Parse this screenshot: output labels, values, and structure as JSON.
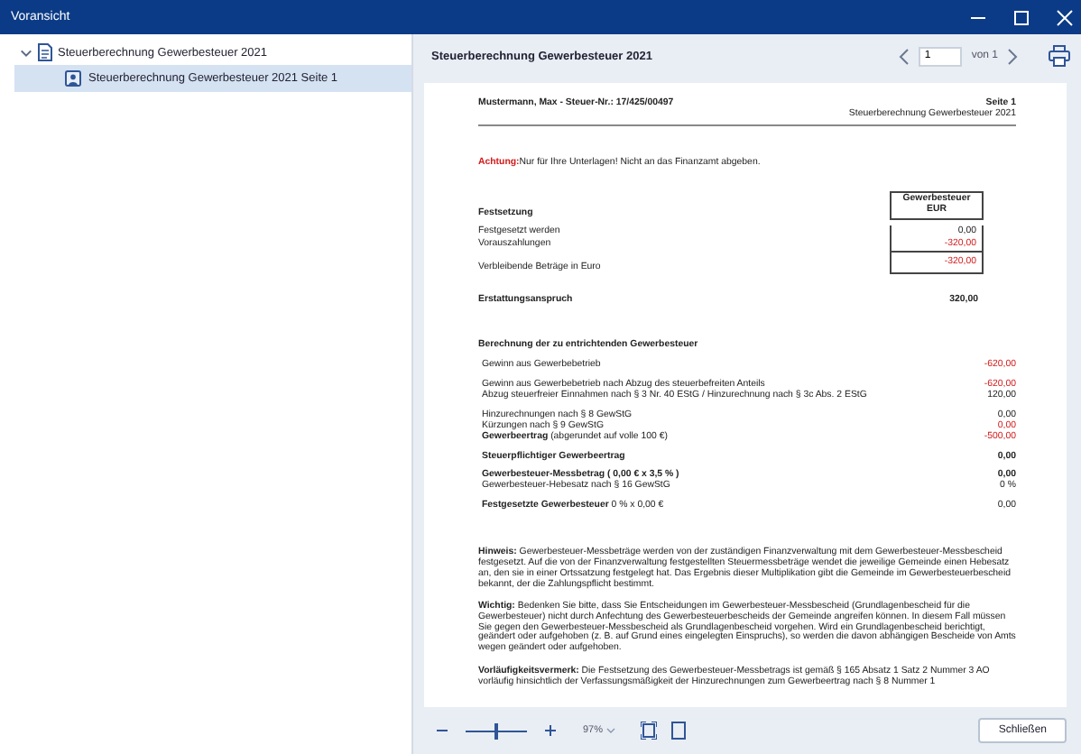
{
  "window": {
    "title": "Voransicht"
  },
  "tree": [
    {
      "label": "Steuerberechnung Gewerbesteuer 2021",
      "expanded": true,
      "children": [
        {
          "label": "Steuerberechnung Gewerbesteuer 2021 Seite 1",
          "selected": true
        }
      ]
    }
  ],
  "viewer": {
    "title": "Steuerberechnung Gewerbesteuer 2021",
    "page": "1",
    "page_total": "von 1"
  },
  "document": {
    "header_left": "Mustermann, Max - Steuer-Nr.: 17/425/00497",
    "header_page": "Seite 1",
    "header_title": "Steuerberechnung Gewerbesteuer 2021",
    "notice": {
      "label": "Achtung:",
      "text": "Nur für Ihre Unterlagen! Nicht an das Finanzamt abgeben."
    },
    "festsetzung": {
      "heading": "Festsetzung",
      "column_header": [
        "Gewerbesteuer",
        "EUR"
      ],
      "rows": [
        {
          "label": "Festgesetzt werden",
          "value": "0,00",
          "negative": false,
          "total": false
        },
        {
          "label": "Vorauszahlungen",
          "value": "-320,00",
          "negative": true,
          "total": false
        },
        {
          "label": "Verbleibende Beträge in Euro",
          "value": "-320,00",
          "negative": true,
          "total": true
        }
      ]
    },
    "erstattung": {
      "label": "Erstattungsanspruch",
      "value": "320,00"
    },
    "berechnung": {
      "heading": "Berechnung der zu entrichtenden Gewerbesteuer",
      "groups": [
        [
          {
            "label": "Gewinn aus Gewerbebetrieb",
            "value": "-620,00",
            "negative": true,
            "bold": false
          }
        ],
        [
          {
            "label": "Gewinn aus Gewerbebetrieb nach Abzug des steuerbefreiten Anteils",
            "value": "-620,00",
            "negative": true,
            "bold": false
          },
          {
            "label": "Abzug steuerfreier Einnahmen nach § 3 Nr. 40 EStG / Hinzurechnung nach § 3c Abs. 2 EStG",
            "value": "120,00",
            "negative": false,
            "bold": false
          }
        ],
        [
          {
            "label": "Hinzurechnungen nach § 8 GewStG",
            "value": "0,00",
            "negative": false,
            "bold": false
          },
          {
            "label": "Kürzungen nach § 9 GewStG",
            "value": "0,00",
            "negative": true,
            "bold": false
          },
          {
            "label": "**Gewerbeertrag** (abgerundet auf volle 100 €)",
            "value": "-500,00",
            "negative": true,
            "bold": false
          }
        ],
        [
          {
            "label": "Steuerpflichtiger Gewerbeertrag",
            "value": "0,00",
            "negative": false,
            "bold": true
          }
        ],
        [
          {
            "label": "Gewerbesteuer-Messbetrag ( 0,00 € x 3,5 % )",
            "value": "0,00",
            "negative": false,
            "bold": true
          },
          {
            "label": "Gewerbesteuer-Hebesatz nach § 16 GewStG",
            "value": "0 %",
            "negative": false,
            "bold": false
          }
        ],
        [
          {
            "label": "**Festgesetzte Gewerbesteuer** 0 % x 0,00 €",
            "value": "0,00",
            "negative": false,
            "bold": false
          }
        ]
      ]
    },
    "hints": [
      "**Hinweis:** Gewerbesteuer-Messbeträge werden von der zuständigen Finanzverwaltung mit dem Gewerbesteuer-Messbescheid festgesetzt. Auf die von der Finanzverwaltung festgestellten Steuermessbeträge wendet die jeweilige Gemeinde einen Hebesatz an, den sie in einer Ortssatzung festgelegt hat. Das Ergebnis dieser Multiplikation gibt die Gemeinde im Gewerbesteuerbescheid bekannt, der die Zahlungspflicht bestimmt.",
      "**Wichtig:** Bedenken Sie bitte, dass Sie Entscheidungen im Gewerbesteuer-Messbescheid (Grundlagenbescheid für die Gewerbesteuer) nicht durch Anfechtung des Gewerbesteuerbescheids der Gemeinde angreifen können. In diesem Fall müssen Sie gegen den Gewerbesteuer-Messbescheid als Grundlagenbescheid vorgehen. Wird ein Grundlagenbescheid berichtigt, geändert oder aufgehoben (z. B. auf Grund eines eingelegten Einspruchs), so werden die davon abhängigen Bescheide von Amts wegen geändert oder aufgehoben.",
      "**Vorläufigkeitsvermerk:** Die Festsetzung des Gewerbesteuer-Messbetrags ist gemäß § 165 Absatz 1 Satz 2 Nummer 3 AO vorläufig hinsichtlich der Verfassungsmäßigkeit der Hinzurechnungen zum Gewerbeertrag nach § 8 Nummer 1"
    ]
  },
  "footer": {
    "zoom": {
      "level": 0.5
    },
    "zoom_value": "97%",
    "close_button": "Schließen"
  }
}
